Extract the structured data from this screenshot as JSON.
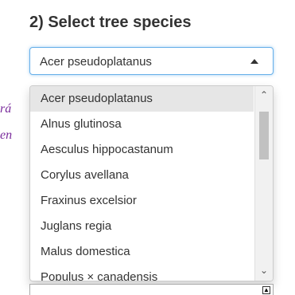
{
  "section": {
    "title": "2) Select tree species"
  },
  "select": {
    "value": "Acer pseudoplatanus"
  },
  "background_text": {
    "line1": "rá",
    "line2": "en"
  },
  "dropdown": {
    "options": [
      "Acer pseudoplatanus",
      "Alnus glutinosa",
      "Aesculus hippocastanum",
      "Corylus avellana",
      "Fraxinus excelsior",
      "Juglans regia",
      "Malus domestica",
      "Populus × canadensis"
    ],
    "highlighted": "Acer pseudoplatanus"
  },
  "icons": {
    "caret": "caret-up-icon",
    "scroll_up": "chevron-up-icon",
    "scroll_down": "chevron-down-icon"
  },
  "colors": {
    "focus_border": "#66afe9",
    "highlight": "#e6e6e6",
    "side_text": "#7a2c9c"
  }
}
